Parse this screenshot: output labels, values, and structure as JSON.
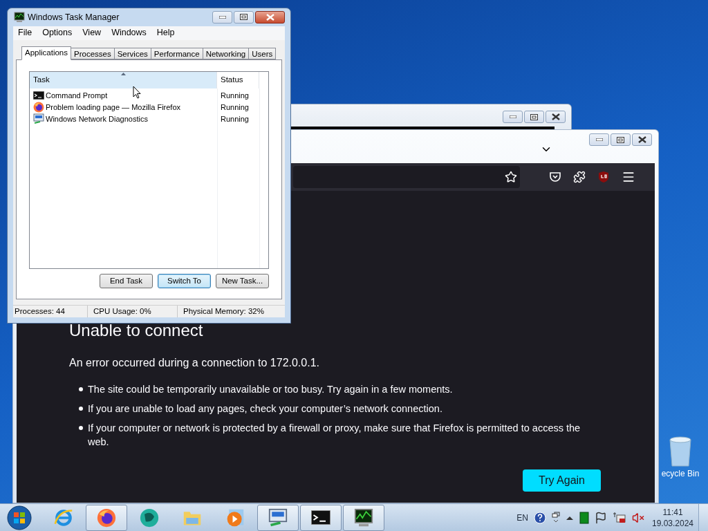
{
  "task_manager": {
    "title": "Windows Task Manager",
    "active": true,
    "menu": [
      "File",
      "Options",
      "View",
      "Windows",
      "Help"
    ],
    "tabs": [
      {
        "label": "Applications",
        "selected": true
      },
      {
        "label": "Processes",
        "selected": false
      },
      {
        "label": "Services",
        "selected": false
      },
      {
        "label": "Performance",
        "selected": false
      },
      {
        "label": "Networking",
        "selected": false
      },
      {
        "label": "Users",
        "selected": false
      }
    ],
    "columns": [
      "Task",
      "Status"
    ],
    "rows": [
      {
        "kind": "console",
        "task": "Command Prompt",
        "status": "Running"
      },
      {
        "kind": "firefox",
        "task": "Problem loading page — Mozilla Firefox",
        "status": "Running"
      },
      {
        "kind": "network",
        "task": "Windows Network Diagnostics",
        "status": "Running"
      }
    ],
    "buttons": [
      {
        "label": "End Task",
        "focused": false
      },
      {
        "label": "Switch To",
        "focused": true
      },
      {
        "label": "New Task...",
        "focused": false
      }
    ],
    "status_bar": [
      "Processes: 44",
      "CPU Usage: 0%",
      "Physical Memory: 32%"
    ]
  },
  "back_window": {
    "active": false
  },
  "firefox": {
    "active": false,
    "heading": "Unable to connect",
    "message": "An error occurred during a connection to 172.0.0.1.",
    "bullets": [
      "The site could be temporarily unavailable or too busy. Try again in a few moments.",
      "If you are unable to load any pages, check your computer’s network connection.",
      "If your computer or network is protected by a firewall or proxy, make sure that Firefox is permitted to access the web."
    ],
    "button": "Try Again"
  },
  "desktop_icons": [
    {
      "label": "ecycle Bin"
    }
  ],
  "taskbar": {
    "items": [
      {
        "kind": "ie",
        "running": false
      },
      {
        "kind": "firefox",
        "running": true
      },
      {
        "kind": "swirl",
        "running": false
      },
      {
        "kind": "explorer",
        "running": false
      },
      {
        "kind": "media",
        "running": false
      },
      {
        "kind": "network",
        "running": true
      },
      {
        "kind": "console",
        "running": true
      },
      {
        "kind": "monitor",
        "running": true
      }
    ],
    "language": "EN",
    "time": "11:41",
    "date": "19.03.2024"
  }
}
